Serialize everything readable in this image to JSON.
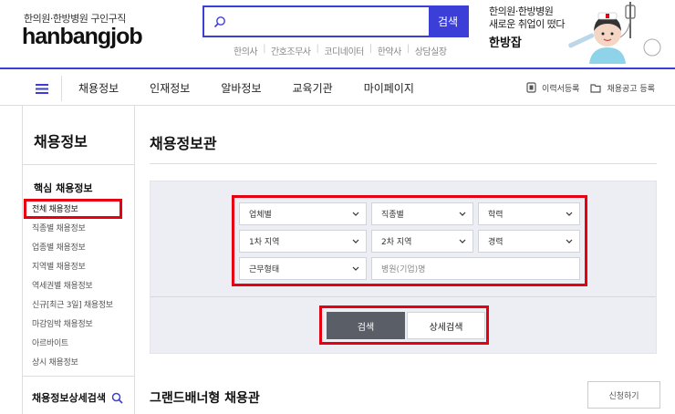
{
  "header": {
    "tagline": "한의원·한방병원 구인구직",
    "logo": "hanbangjob",
    "search": {
      "placeholder": "",
      "button": "검색"
    },
    "quick_links": [
      "한의사",
      "간호조무사",
      "코디네이터",
      "한약사",
      "상담실장"
    ],
    "promo": {
      "line1": "한의원·한방병원",
      "line2": "새로운 취업이 떴다",
      "brand": "한방잡"
    }
  },
  "nav": {
    "menu": [
      "채용정보",
      "인재정보",
      "알바정보",
      "교육기관",
      "마이페이지"
    ],
    "actions": [
      "이력서등록",
      "채용공고 등록"
    ]
  },
  "sidebar": {
    "title": "채용정보",
    "section": "핵심 채용정보",
    "items": [
      "전체 채용정보",
      "직종별 채용정보",
      "업종별 채용정보",
      "지역별 채용정보",
      "역세권별 채용정보",
      "신규[최근 3일] 채용정보",
      "마감임박 채용정보",
      "아르바이트",
      "상시 채용정보"
    ],
    "detail_search": "채용정보상세검색"
  },
  "main": {
    "title": "채용정보관",
    "filters": {
      "row1": [
        "업체별",
        "직종별",
        "학력"
      ],
      "row2": [
        "1차 지역",
        "2차 지역",
        "경력"
      ],
      "row3_select": "근무형태",
      "row3_input_placeholder": "병원(기업)명"
    },
    "buttons": {
      "search": "검색",
      "detail": "상세검색"
    },
    "brand_banner_title": "그랜드배너형 채용관",
    "apply_button": "신청하기"
  },
  "colors": {
    "accent": "#3b3fd8",
    "highlight": "#e60012",
    "panel": "#eceef3",
    "dark_button": "#5a5e67"
  }
}
